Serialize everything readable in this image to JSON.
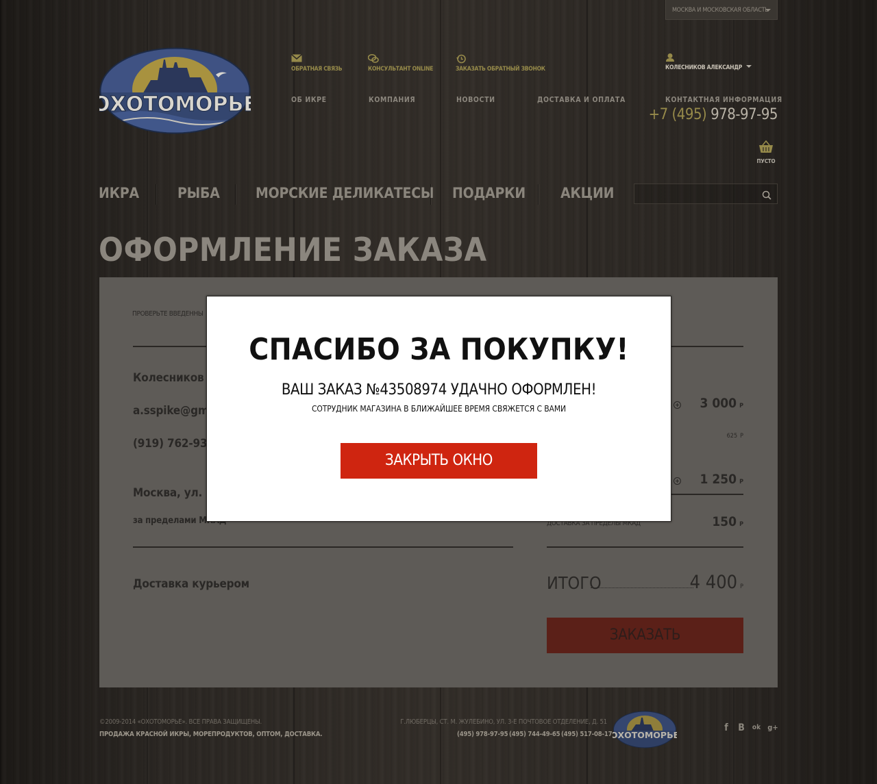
{
  "region": {
    "label": "МОСКВА И МОСКОВСКАЯ ОБЛАСТЬ"
  },
  "logo": {
    "text": "ОХОТОМОРЬЕ"
  },
  "top_links": [
    {
      "label": "ОБРАТНАЯ СВЯЗЬ",
      "icon": "envelope-icon"
    },
    {
      "label": "КОНСУЛЬТАНТ ONLINE",
      "icon": "chat-icon"
    },
    {
      "label": "ЗАКАЗАТЬ ОБРАТНЫЙ ЗВОНОК",
      "icon": "callback-icon"
    }
  ],
  "user": {
    "name": "КОЛЕСНИКОВ АЛЕКСАНДР",
    "icon": "user-icon"
  },
  "info_nav": [
    {
      "label": "ОБ ИКРЕ"
    },
    {
      "label": "КОМПАНИЯ"
    },
    {
      "label": "НОВОСТИ"
    },
    {
      "label": "ДОСТАВКА И ОПЛАТА"
    }
  ],
  "contacts": {
    "title": "КОНТАКТНАЯ ИНФОРМАЦИЯ",
    "phone_code": "+7 (495)",
    "phone_number": "978-97-95"
  },
  "cart": {
    "label": "ПУСТО",
    "icon": "basket-icon"
  },
  "main_menu": [
    {
      "label": "ИКРА"
    },
    {
      "label": "РЫБА"
    },
    {
      "label": "МОРСКИЕ ДЕЛИКАТЕСЫ"
    },
    {
      "label": "ПОДАРКИ"
    },
    {
      "label": "АКЦИИ"
    }
  ],
  "search": {
    "placeholder": "",
    "icon": "search-icon"
  },
  "page_title": "ОФОРМЛЕНИЕ ЗАКАЗА",
  "checkout": {
    "hint": "ПРОВЕРЬТЕ ВВЕДЕННЫ",
    "name": "Колесников А",
    "email": "a.sspike@gma",
    "phone": "(919) 762-93-8",
    "address": "Москва, ул. Ва",
    "zone": "за пределами МКАД",
    "delivery_method": "Доставка курьером",
    "items": [
      {
        "price": "3 000",
        "currency": "Р"
      },
      {
        "price": "625",
        "currency": "Р"
      },
      {
        "price": "1 250",
        "currency": "Р"
      }
    ],
    "delivery": {
      "label": "ДОСТАВКА ЗА ПРЕДЕЛЫ МКАД",
      "price": "150",
      "currency": "Р"
    },
    "total": {
      "label": "ИТОГО",
      "value": "4 400",
      "currency": "Р"
    },
    "order_button": "ЗАКАЗАТЬ"
  },
  "modal": {
    "title": "СПАСИБО ЗА ПОКУПКУ!",
    "subtitle": "ВАШ ЗАКАЗ №43508974 УДАЧНО ОФОРМЛЕН!",
    "note": "СОТРУДНИК МАГАЗИНА В БЛИЖАЙШЕЕ ВРЕМЯ СВЯЖЕТСЯ С ВАМИ",
    "close_button": "ЗАКРЫТЬ ОКНО",
    "accent": "#cf2510"
  },
  "footer": {
    "copyright": "©2009-2014 «ОХОТОМОРЬЕ». ВСЕ ПРАВА ЗАЩИЩЕНЫ.",
    "slogan": "ПРОДАЖА КРАСНОЙ ИКРЫ, МОРЕПРОДУКТОВ, ОПТОМ, ДОСТАВКА.",
    "address": "Г.ЛЮБЕРЦЫ, СТ. М. ЖУЛЕБИНО, УЛ. 3-Е ПОЧТОВОЕ ОТДЕЛЕНИЕ, Д. 51",
    "phones": [
      "(495) 978-97-95",
      "(495) 744-49-65",
      "(495) 517-08-17"
    ],
    "logo_text": "ОХОТОМОРЬЕ",
    "social": [
      {
        "label": "f",
        "icon": "facebook-icon"
      },
      {
        "label": "В",
        "icon": "vk-icon"
      },
      {
        "label": "ok",
        "icon": "odnoklassniki-icon"
      },
      {
        "label": "g+",
        "icon": "googleplus-icon"
      }
    ]
  }
}
